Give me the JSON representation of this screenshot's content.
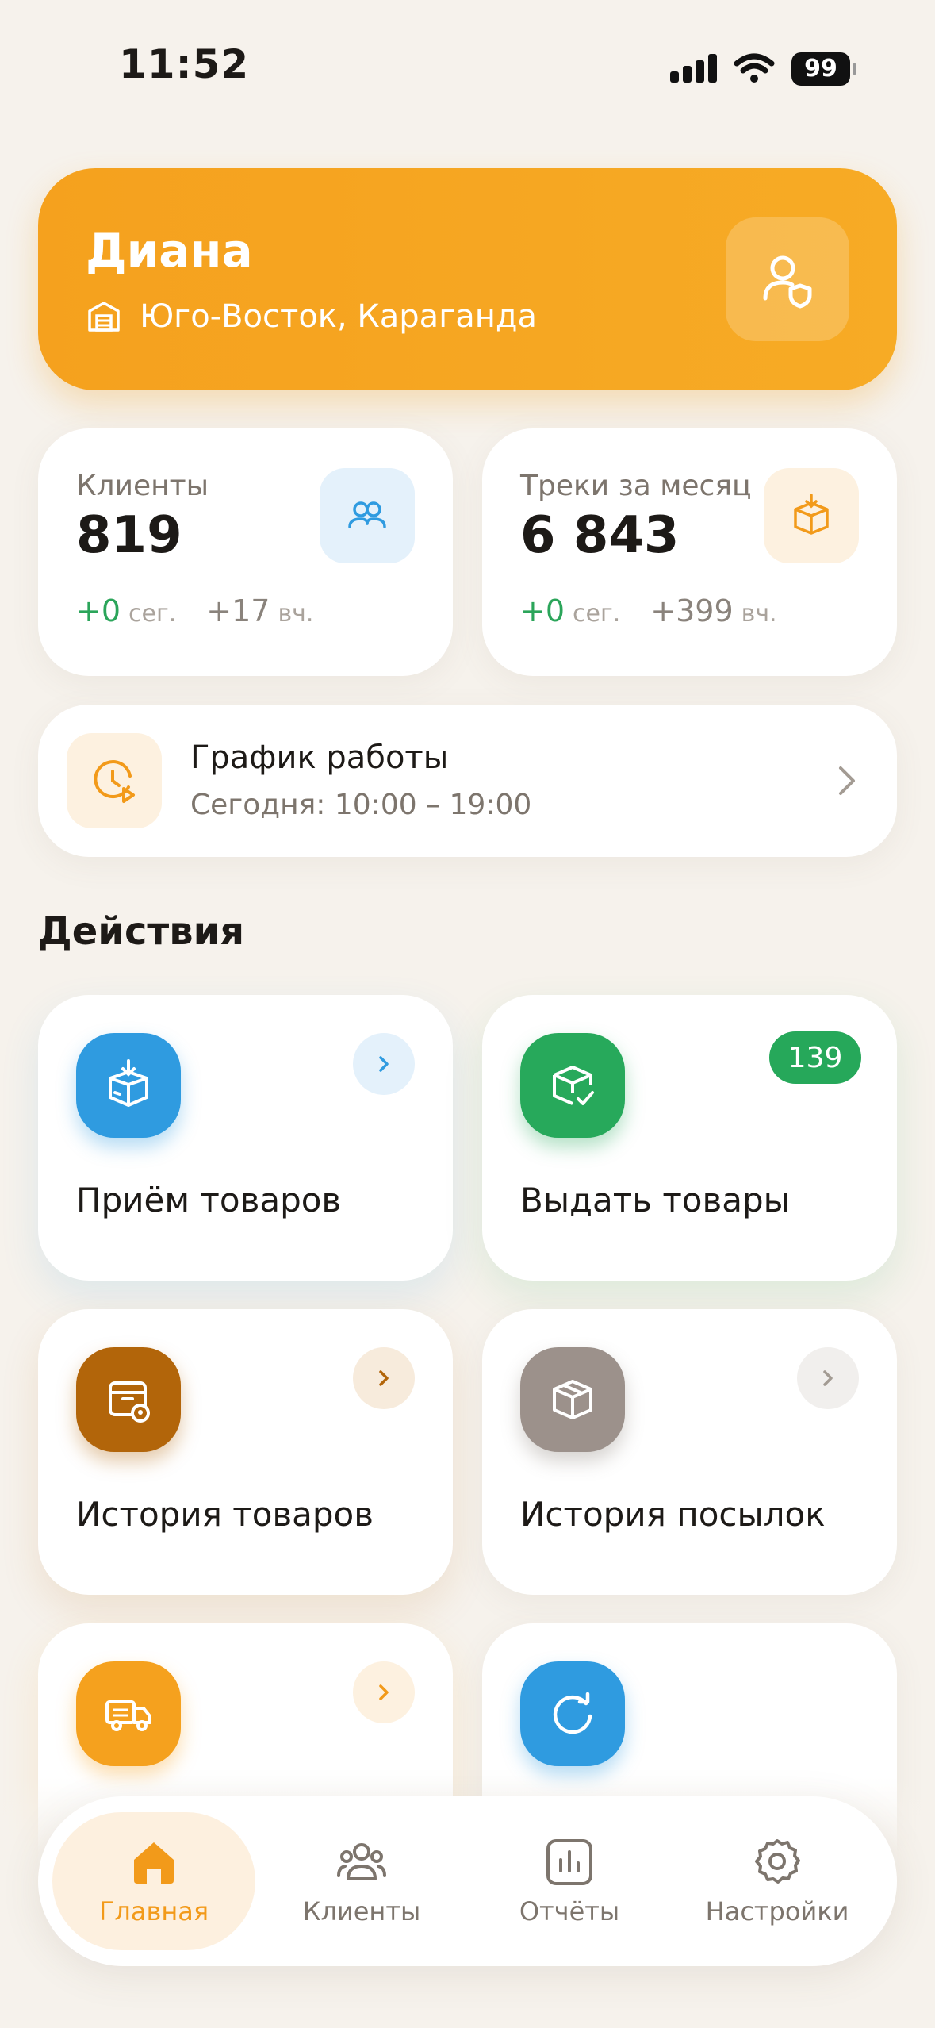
{
  "status_bar": {
    "time": "11:52",
    "battery": "99"
  },
  "header": {
    "name": "Диана",
    "location": "Юго-Восток, Караганда"
  },
  "stats": [
    {
      "label": "Клиенты",
      "value": "819",
      "delta_today": "+0",
      "delta_today_unit": "сег.",
      "delta_yesterday": "+17",
      "delta_yesterday_unit": "вч."
    },
    {
      "label": "Треки за месяц",
      "value": "6 843",
      "delta_today": "+0",
      "delta_today_unit": "сег.",
      "delta_yesterday": "+399",
      "delta_yesterday_unit": "вч."
    }
  ],
  "schedule": {
    "title": "График работы",
    "subtitle": "Сегодня: 10:00 – 19:00"
  },
  "actions_title": "Действия",
  "actions": [
    {
      "label": "Приём товаров",
      "color": "#2f9be0"
    },
    {
      "label": "Выдать товары",
      "color": "#27a95b",
      "badge": "139"
    },
    {
      "label": "История товаров",
      "color": "#b2650a"
    },
    {
      "label": "История посылок",
      "color": "#9c918b"
    },
    {
      "label": "",
      "color": "#f5a11e"
    },
    {
      "label": "",
      "color": "#2f9be0"
    }
  ],
  "nav": [
    {
      "label": "Главная",
      "active": true
    },
    {
      "label": "Клиенты"
    },
    {
      "label": "Отчёты"
    },
    {
      "label": "Настройки"
    }
  ],
  "colors": {
    "accent": "#f5a11e",
    "background": "#f6f2ec",
    "green": "#2ba55a"
  }
}
